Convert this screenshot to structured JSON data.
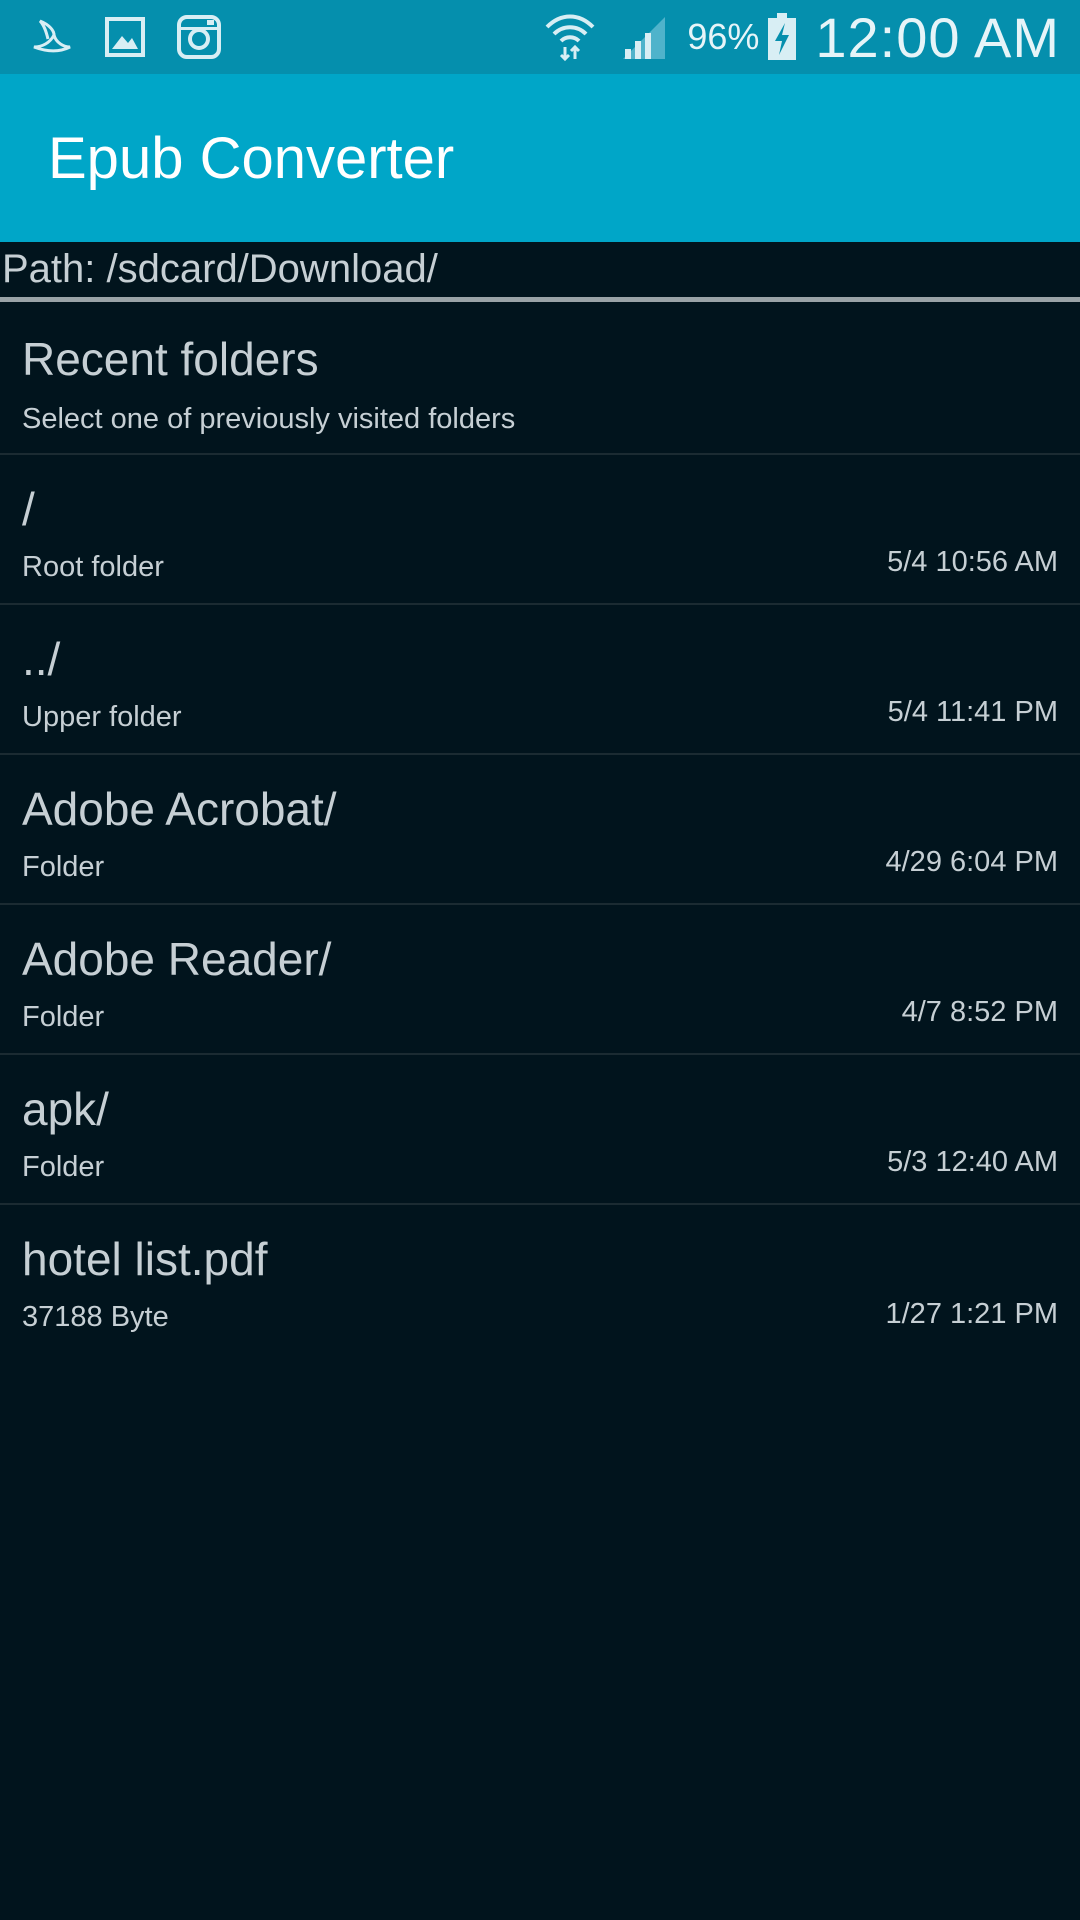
{
  "status_bar": {
    "battery_percent": "96%",
    "time": "12:00 AM",
    "left_icons": [
      "bird-icon",
      "gallery-icon",
      "instagram-icon"
    ],
    "right_icons": [
      "wifi-icon",
      "signal-icon",
      "battery-charging-icon"
    ]
  },
  "app_bar": {
    "title": "Epub Converter",
    "color": "#00a6c8"
  },
  "path": {
    "text": "Path: /sdcard/Download/"
  },
  "list": {
    "recent": {
      "title": "Recent folders",
      "subtitle": "Select one of previously visited folders"
    },
    "items": [
      {
        "name": "/",
        "type": "Root folder",
        "time": "5/4 10:56 AM"
      },
      {
        "name": "../",
        "type": "Upper folder",
        "time": "5/4 11:41 PM"
      },
      {
        "name": "Adobe Acrobat/",
        "type": "Folder",
        "time": "4/29 6:04 PM"
      },
      {
        "name": "Adobe Reader/",
        "type": "Folder",
        "time": "4/7 8:52 PM"
      },
      {
        "name": "apk/",
        "type": "Folder",
        "time": "5/3 12:40 AM"
      },
      {
        "name": "hotel list.pdf",
        "type": "37188 Byte",
        "time": "1/27 1:21 PM"
      }
    ]
  },
  "colors": {
    "status_bar": "#058fad",
    "background": "#01141d",
    "text": "#c6cfd4"
  }
}
